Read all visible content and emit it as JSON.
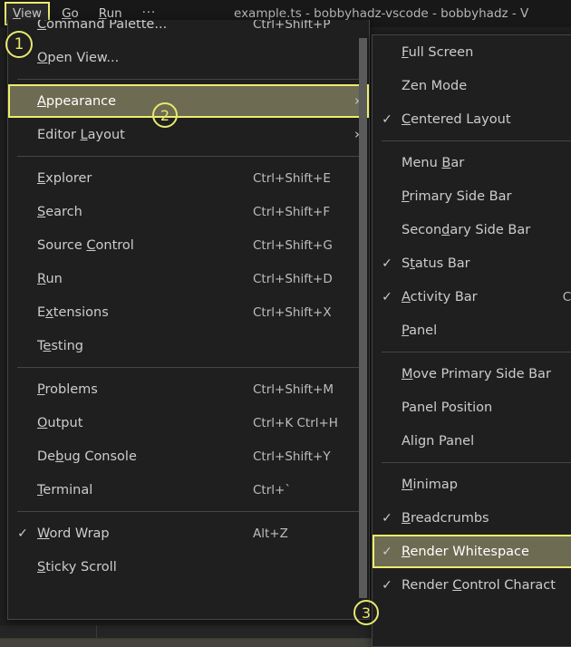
{
  "window": {
    "title": "example.ts - bobbyhadz-vscode - bobbyhadz - V",
    "background_color": "#1f1f1f",
    "titlebar_color": "#181818"
  },
  "menubar": {
    "items": [
      {
        "label": "View",
        "accel": "V",
        "active": true
      },
      {
        "label": "Go",
        "accel": "G",
        "active": false
      },
      {
        "label": "Run",
        "accel": "R",
        "active": false
      },
      {
        "label": "···",
        "accel": "",
        "active": false
      }
    ]
  },
  "view_menu": {
    "name": "View",
    "groups": [
      {
        "items": [
          {
            "check": "",
            "label": "Command Palette...",
            "accel": "C",
            "shortcut": "Ctrl+Shift+P",
            "submenu": false,
            "highlight": false
          },
          {
            "check": "",
            "label": "Open View...",
            "accel": "O",
            "shortcut": "",
            "submenu": false,
            "highlight": false
          }
        ]
      },
      {
        "items": [
          {
            "check": "",
            "label": "Appearance",
            "accel": "A",
            "shortcut": "",
            "submenu": true,
            "highlight": true
          },
          {
            "check": "",
            "label": "Editor Layout",
            "accel": "L",
            "shortcut": "",
            "submenu": true,
            "highlight": false
          }
        ]
      },
      {
        "items": [
          {
            "check": "",
            "label": "Explorer",
            "accel": "E",
            "shortcut": "Ctrl+Shift+E",
            "submenu": false,
            "highlight": false
          },
          {
            "check": "",
            "label": "Search",
            "accel": "S",
            "shortcut": "Ctrl+Shift+F",
            "submenu": false,
            "highlight": false
          },
          {
            "check": "",
            "label": "Source Control",
            "accel": "C",
            "shortcut": "Ctrl+Shift+G",
            "submenu": false,
            "highlight": false
          },
          {
            "check": "",
            "label": "Run",
            "accel": "R",
            "shortcut": "Ctrl+Shift+D",
            "submenu": false,
            "highlight": false
          },
          {
            "check": "",
            "label": "Extensions",
            "accel": "x",
            "shortcut": "Ctrl+Shift+X",
            "submenu": false,
            "highlight": false
          },
          {
            "check": "",
            "label": "Testing",
            "accel": "e",
            "shortcut": "",
            "submenu": false,
            "highlight": false
          }
        ]
      },
      {
        "items": [
          {
            "check": "",
            "label": "Problems",
            "accel": "P",
            "shortcut": "Ctrl+Shift+M",
            "submenu": false,
            "highlight": false
          },
          {
            "check": "",
            "label": "Output",
            "accel": "O",
            "shortcut": "Ctrl+K Ctrl+H",
            "submenu": false,
            "highlight": false
          },
          {
            "check": "",
            "label": "Debug Console",
            "accel": "b",
            "shortcut": "Ctrl+Shift+Y",
            "submenu": false,
            "highlight": false
          },
          {
            "check": "",
            "label": "Terminal",
            "accel": "T",
            "shortcut": "Ctrl+`",
            "submenu": false,
            "highlight": false
          }
        ]
      },
      {
        "items": [
          {
            "check": "✓",
            "label": "Word Wrap",
            "accel": "W",
            "shortcut": "Alt+Z",
            "submenu": false,
            "highlight": false
          },
          {
            "check": "",
            "label": "Sticky Scroll",
            "accel": "S",
            "shortcut": "",
            "submenu": false,
            "highlight": false
          }
        ]
      }
    ]
  },
  "appearance_menu": {
    "name": "Appearance",
    "groups": [
      {
        "items": [
          {
            "check": "",
            "label": "Full Screen",
            "accel": "F",
            "shortcut": "",
            "highlight": false
          },
          {
            "check": "",
            "label": "Zen Mode",
            "accel": "",
            "shortcut": "",
            "highlight": false
          },
          {
            "check": "✓",
            "label": "Centered Layout",
            "accel": "C",
            "shortcut": "",
            "highlight": false
          }
        ]
      },
      {
        "items": [
          {
            "check": "",
            "label": "Menu Bar",
            "accel": "B",
            "shortcut": "",
            "highlight": false
          },
          {
            "check": "",
            "label": "Primary Side Bar",
            "accel": "P",
            "shortcut": "",
            "highlight": false
          },
          {
            "check": "",
            "label": "Secondary Side Bar",
            "accel": "d",
            "shortcut": "",
            "highlight": false
          },
          {
            "check": "✓",
            "label": "Status Bar",
            "accel": "t",
            "shortcut": "",
            "highlight": false
          },
          {
            "check": "✓",
            "label": "Activity Bar",
            "accel": "A",
            "shortcut": "Ctr",
            "highlight": false
          },
          {
            "check": "",
            "label": "Panel",
            "accel": "P",
            "shortcut": "",
            "highlight": false
          }
        ]
      },
      {
        "items": [
          {
            "check": "",
            "label": "Move Primary Side Bar",
            "accel": "M",
            "shortcut": "",
            "highlight": false
          },
          {
            "check": "",
            "label": "Panel Position",
            "accel": "",
            "shortcut": "",
            "highlight": false
          },
          {
            "check": "",
            "label": "Align Panel",
            "accel": "",
            "shortcut": "",
            "highlight": false
          }
        ]
      },
      {
        "items": [
          {
            "check": "",
            "label": "Minimap",
            "accel": "M",
            "shortcut": "",
            "highlight": false
          },
          {
            "check": "✓",
            "label": "Breadcrumbs",
            "accel": "B",
            "shortcut": "",
            "highlight": false
          },
          {
            "check": "✓",
            "label": "Render Whitespace",
            "accel": "R",
            "shortcut": "",
            "highlight": true
          },
          {
            "check": "✓",
            "label": "Render Control Charact",
            "accel": "C",
            "shortcut": "",
            "highlight": false
          }
        ]
      }
    ]
  },
  "annotations": [
    {
      "id": "1",
      "text": "1"
    },
    {
      "id": "2",
      "text": "2"
    },
    {
      "id": "3",
      "text": "3"
    }
  ],
  "colors": {
    "highlight_bg": "#6d6b52",
    "highlight_border": "#eded6e",
    "menu_bg": "#1f1f1f",
    "menu_text": "#cccccc",
    "separator": "#454545"
  }
}
